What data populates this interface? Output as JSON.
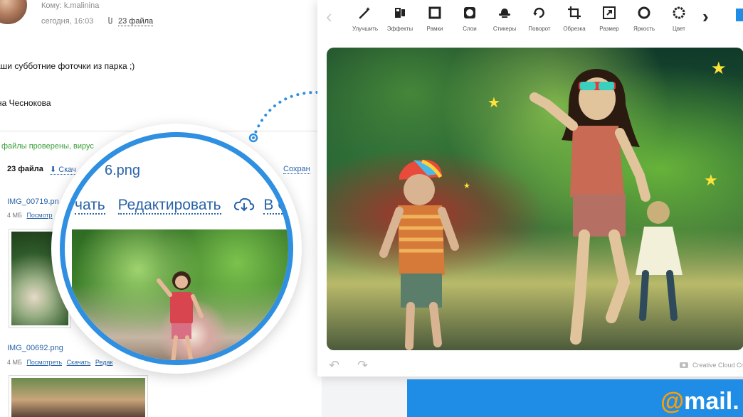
{
  "mail": {
    "to": "Кому: k.malinina",
    "date": "сегодня, 16:03",
    "attachments": "23 файла",
    "body_line1": "аши субботние фоточки из парка ;)",
    "body_line2": "на Чеснокова",
    "virus_status": "файлы проверены, вирус",
    "files_count": "23 файла",
    "download_all": "Скач",
    "save_all": "Сохран",
    "files": [
      {
        "name": "IMG_00719.pn",
        "size": "4 МБ",
        "view": "Посмотр"
      },
      {
        "name": "IMG_00692.png",
        "size": "4 МБ",
        "view": "Посмотреть",
        "download": "Скачать",
        "edit": "Редак"
      }
    ]
  },
  "magnifier": {
    "title": "6.png",
    "download": "чать",
    "edit": "Редактировать",
    "cloud": "В С"
  },
  "editor": {
    "tools": [
      {
        "label": "Улучшить",
        "icon": "magic-wand-icon"
      },
      {
        "label": "Эффекты",
        "icon": "effects-icon"
      },
      {
        "label": "Рамки",
        "icon": "frame-icon"
      },
      {
        "label": "Слои",
        "icon": "layers-icon"
      },
      {
        "label": "Стикеры",
        "icon": "sticker-hat-icon"
      },
      {
        "label": "Поворот",
        "icon": "rotate-icon"
      },
      {
        "label": "Обрезка",
        "icon": "crop-icon"
      },
      {
        "label": "Размер",
        "icon": "resize-icon"
      },
      {
        "label": "Яркость",
        "icon": "brightness-icon"
      },
      {
        "label": "Цвет",
        "icon": "color-icon"
      }
    ],
    "prev_arrow": "‹",
    "next_arrow": "›",
    "undo": "↶",
    "redo": "↷",
    "credit": "Creative Cloud Cr"
  },
  "brand": {
    "at": "@",
    "name": "mail."
  },
  "colors": {
    "accent": "#1f8ce6",
    "link": "#2a63a8",
    "ok_green": "#3aa03a",
    "brand_orange": "#ff9e00",
    "star": "#ffe23a"
  }
}
